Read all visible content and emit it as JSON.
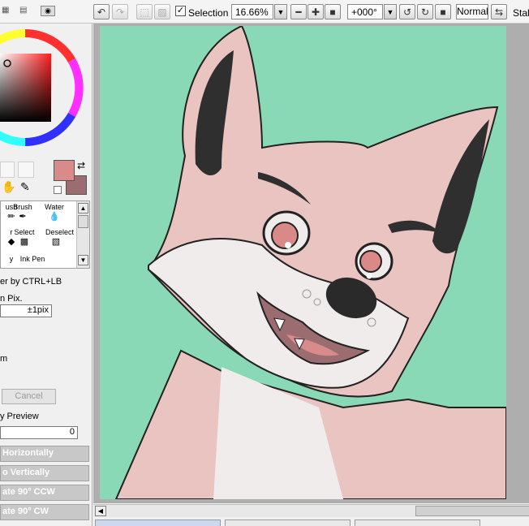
{
  "toolbar": {
    "selection_label": "Selection",
    "selection_checked": "✓",
    "zoom_value": "16.66%",
    "rotation_value": "+000°",
    "blend_mode": "Normal",
    "stab_label": "Stab"
  },
  "tools": {
    "row1": [
      "ush",
      "Brush",
      "Water"
    ],
    "row2": [
      "r",
      "Select",
      "Deselect"
    ],
    "row3": [
      "y",
      "Ink Pen"
    ]
  },
  "options": {
    "drag_hint": "er by CTRL+LB",
    "pix_label": "n Pix.",
    "pix_value": "±1pix",
    "m_label": "m",
    "cancel_label": "Cancel",
    "preview_label": "y Preview",
    "preview_value": "0"
  },
  "transform_buttons": {
    "flip_h": "Horizontally",
    "flip_v": "o Vertically",
    "rot_ccw": "ate 90° CCW",
    "rot_cw": "ate 90° CW"
  },
  "colors": {
    "canvas_bg": "#8ad9b6",
    "fur_pink": "#e9c4c0",
    "fur_white": "#f1ecec",
    "ear_dark": "#2f2f2f",
    "eye_red": "#d98a88",
    "fg_swatch": "#d88b8b",
    "bg_swatch": "#9b6c70"
  }
}
